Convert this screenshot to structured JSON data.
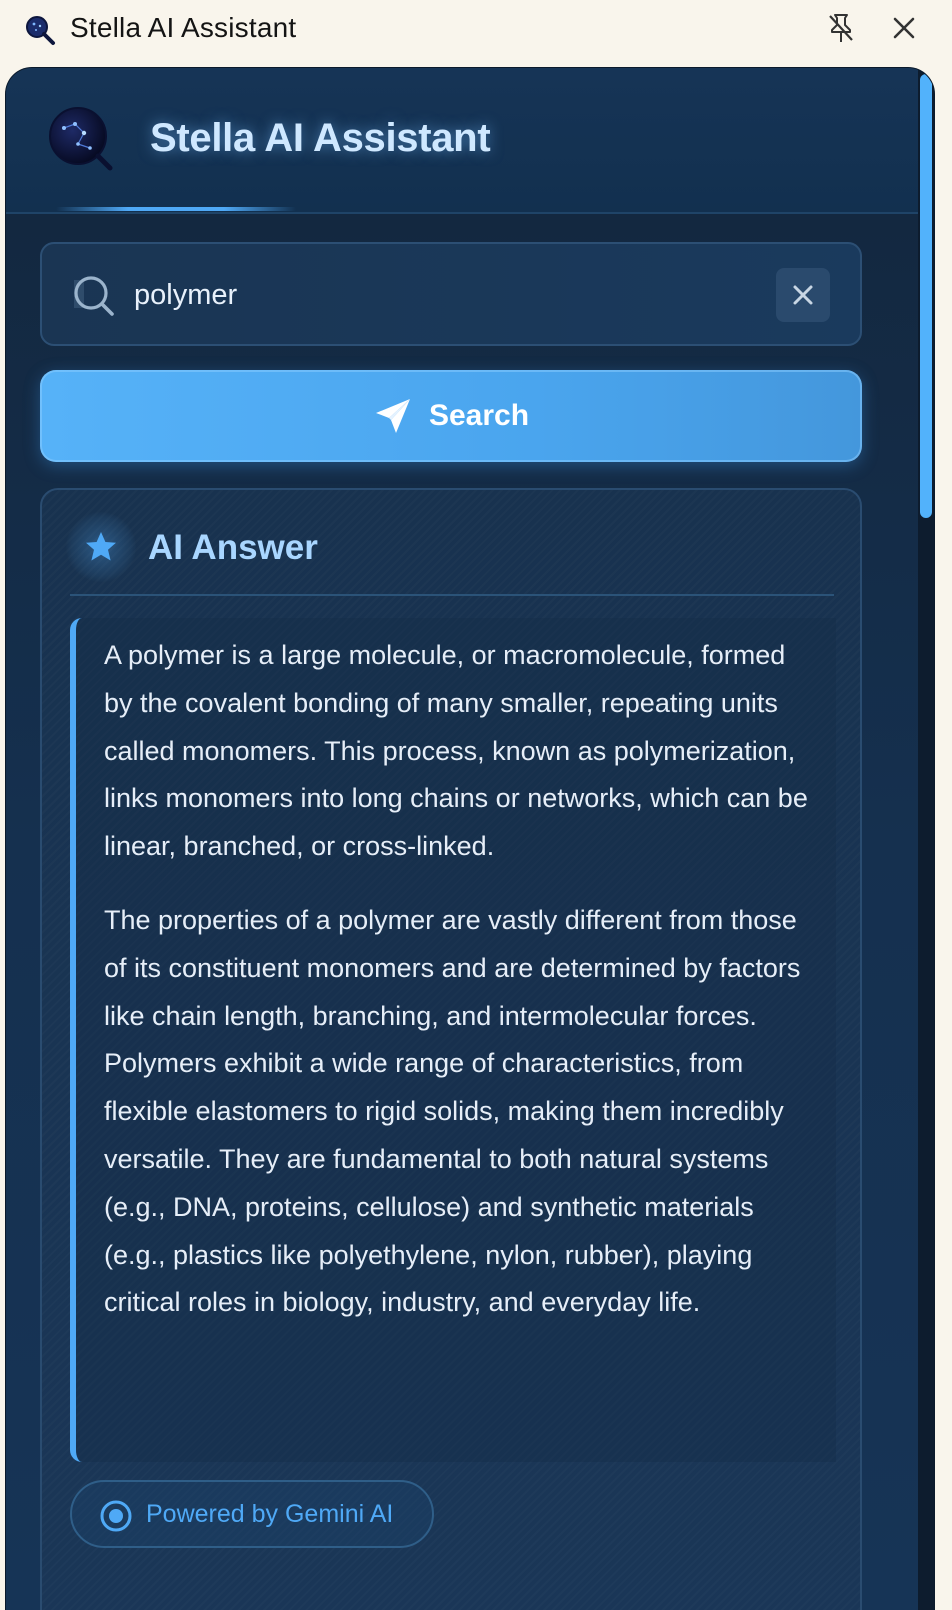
{
  "titlebar": {
    "title": "Stella AI Assistant",
    "app_icon": "magnifier-stars-icon",
    "pin_icon": "unpin-icon",
    "close_icon": "close-icon"
  },
  "header": {
    "brand": "Stella AI Assistant",
    "logo_icon": "constellation-magnifier-icon"
  },
  "search": {
    "value": "polymer",
    "search_icon": "search-icon",
    "clear_icon": "clear-icon"
  },
  "search_button": {
    "label": "Search",
    "icon": "send-icon"
  },
  "answer": {
    "heading": "AI Answer",
    "heading_icon": "star-icon",
    "paragraphs": [
      "A polymer is a large molecule, or macromolecule, formed by the covalent bonding of many smaller, repeating units called monomers. This process, known as polymerization, links monomers into long chains or networks, which can be linear, branched, or cross-linked.",
      "The properties of a polymer are vastly different from those of its constituent monomers and are determined by factors like chain length, branching, and intermolecular forces. Polymers exhibit a wide range of characteristics, from flexible elastomers to rigid solids, making them incredibly versatile. They are fundamental to both natural systems (e.g., DNA, proteins, cellulose) and synthetic materials (e.g., plastics like polyethylene, nylon, rubber), playing critical roles in biology, industry, and everyday life."
    ],
    "powered_by": "Powered by Gemini AI",
    "powered_icon": "target-icon"
  },
  "colors": {
    "accent": "#4fa9f6",
    "brand_text": "#cfe8ff",
    "panel": "#15304f",
    "titlebar_bg": "#f9f5ec"
  }
}
